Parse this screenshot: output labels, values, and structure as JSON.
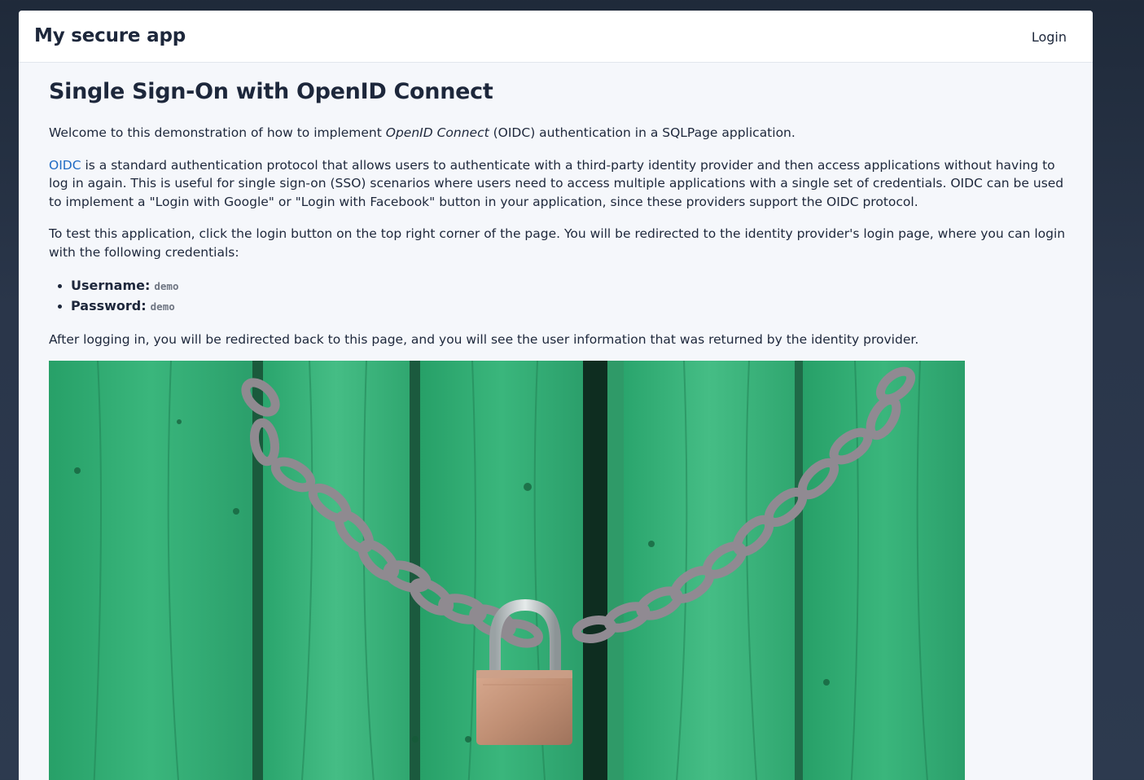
{
  "header": {
    "brand": "My secure app",
    "login_label": "Login"
  },
  "main": {
    "title": "Single Sign-On with OpenID Connect",
    "intro": {
      "before": "Welcome to this demonstration of how to implement ",
      "emphasis": "OpenID Connect",
      "after": " (OIDC) authentication in a SQLPage application."
    },
    "oidc_paragraph": {
      "link_text": "OIDC",
      "text": " is a standard authentication protocol that allows users to authenticate with a third-party identity provider and then access applications without having to log in again. This is useful for single sign-on (SSO) scenarios where users need to access multiple applications with a single set of credentials. OIDC can be used to implement a \"Login with Google\" or \"Login with Facebook\" button in your application, since these providers support the OIDC protocol."
    },
    "test_paragraph": "To test this application, click the login button on the top right corner of the page. You will be redirected to the identity provider's login page, where you can login with the following credentials:",
    "credentials": [
      {
        "label": "Username:",
        "value": "demo"
      },
      {
        "label": "Password:",
        "value": "demo"
      }
    ],
    "after_login": "After logging in, you will be redirected back to this page, and you will see the user information that was returned by the identity provider."
  },
  "image": {
    "icon": "padlock-chain-photo"
  },
  "colors": {
    "link": "#206bc4",
    "background": "#f5f7fb",
    "navbar": "#ffffff",
    "door_green": "#2eaa72"
  }
}
